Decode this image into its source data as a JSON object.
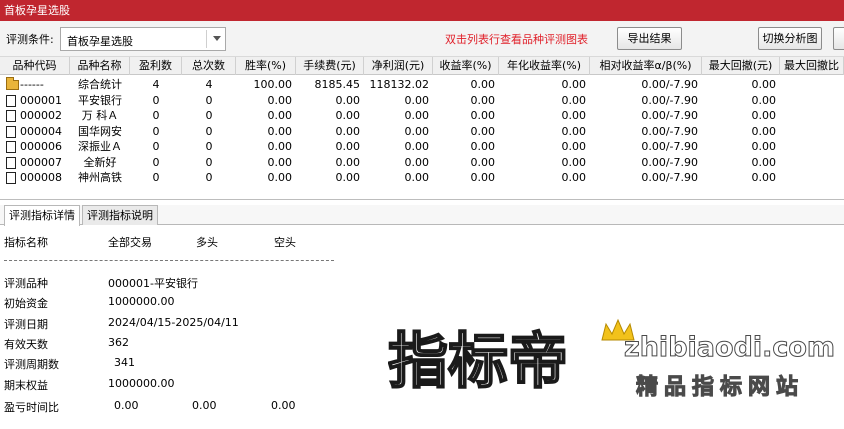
{
  "window": {
    "title": "首板孕星选股"
  },
  "toolbar": {
    "condition_label": "评测条件:",
    "condition_value": "首板孕星选股",
    "hint": "双击列表行查看品种评测图表",
    "export_button": "导出结果",
    "switch_button": "切换分析图"
  },
  "grid": {
    "columns": [
      "品种代码",
      "品种名称",
      "盈利数",
      "总次数",
      "胜率(%)",
      "手续费(元)",
      "净利润(元)",
      "收益率(%)",
      "年化收益率(%)",
      "相对收益率α/β(%)",
      "最大回撤(元)",
      "最大回撤比"
    ],
    "rows": [
      {
        "icon": "folder-icon",
        "code": "------",
        "name": "综合统计",
        "wins": "4",
        "total": "4",
        "winrate": "100.00",
        "fee": "8185.45",
        "profit": "118132.02",
        "yield": "0.00",
        "annual": "0.00",
        "relative": "0.00/-7.90",
        "maxdd": "0.00"
      },
      {
        "icon": "checkbox-icon",
        "code": "000001",
        "name": "平安银行",
        "wins": "0",
        "total": "0",
        "winrate": "0.00",
        "fee": "0.00",
        "profit": "0.00",
        "yield": "0.00",
        "annual": "0.00",
        "relative": "0.00/-7.90",
        "maxdd": "0.00"
      },
      {
        "icon": "checkbox-icon",
        "code": "000002",
        "name": "万 科Ａ",
        "wins": "0",
        "total": "0",
        "winrate": "0.00",
        "fee": "0.00",
        "profit": "0.00",
        "yield": "0.00",
        "annual": "0.00",
        "relative": "0.00/-7.90",
        "maxdd": "0.00"
      },
      {
        "icon": "checkbox-icon",
        "code": "000004",
        "name": "国华网安",
        "wins": "0",
        "total": "0",
        "winrate": "0.00",
        "fee": "0.00",
        "profit": "0.00",
        "yield": "0.00",
        "annual": "0.00",
        "relative": "0.00/-7.90",
        "maxdd": "0.00"
      },
      {
        "icon": "checkbox-icon",
        "code": "000006",
        "name": "深振业Ａ",
        "wins": "0",
        "total": "0",
        "winrate": "0.00",
        "fee": "0.00",
        "profit": "0.00",
        "yield": "0.00",
        "annual": "0.00",
        "relative": "0.00/-7.90",
        "maxdd": "0.00"
      },
      {
        "icon": "checkbox-icon",
        "code": "000007",
        "name": "全新好",
        "wins": "0",
        "total": "0",
        "winrate": "0.00",
        "fee": "0.00",
        "profit": "0.00",
        "yield": "0.00",
        "annual": "0.00",
        "relative": "0.00/-7.90",
        "maxdd": "0.00"
      },
      {
        "icon": "checkbox-icon",
        "code": "000008",
        "name": "神州高铁",
        "wins": "0",
        "total": "0",
        "winrate": "0.00",
        "fee": "0.00",
        "profit": "0.00",
        "yield": "0.00",
        "annual": "0.00",
        "relative": "0.00/-7.90",
        "maxdd": "0.00"
      }
    ]
  },
  "tabs": [
    {
      "label": "评测指标详情"
    },
    {
      "label": "评测指标说明"
    }
  ],
  "detail": {
    "header": {
      "name": "指标名称",
      "all": "全部交易",
      "long": "多头",
      "short": "空头"
    },
    "items": [
      {
        "label": "评测品种",
        "values": [
          "000001-平安银行"
        ]
      },
      {
        "label": "初始资金",
        "values": [
          "1000000.00"
        ]
      },
      {
        "label": "评测日期",
        "values": [
          "2024/04/15-2025/04/11"
        ]
      },
      {
        "label": "有效天数",
        "values": [
          "362"
        ]
      },
      {
        "label": "评测周期数",
        "values": [
          "341"
        ]
      },
      {
        "label": "期末权益",
        "values": [
          "1000000.00"
        ]
      },
      {
        "label": "盈亏时间比",
        "values": [
          "0.00",
          "0.00",
          "0.00"
        ]
      }
    ]
  },
  "watermark": {
    "logo_text": "指标帝",
    "domain": "zhibiaodi.com",
    "slogan": "精品指标网站"
  },
  "colors": {
    "title_bar": "#c0262f",
    "hint_text": "#e0202a",
    "crown": "#f2c21b"
  }
}
